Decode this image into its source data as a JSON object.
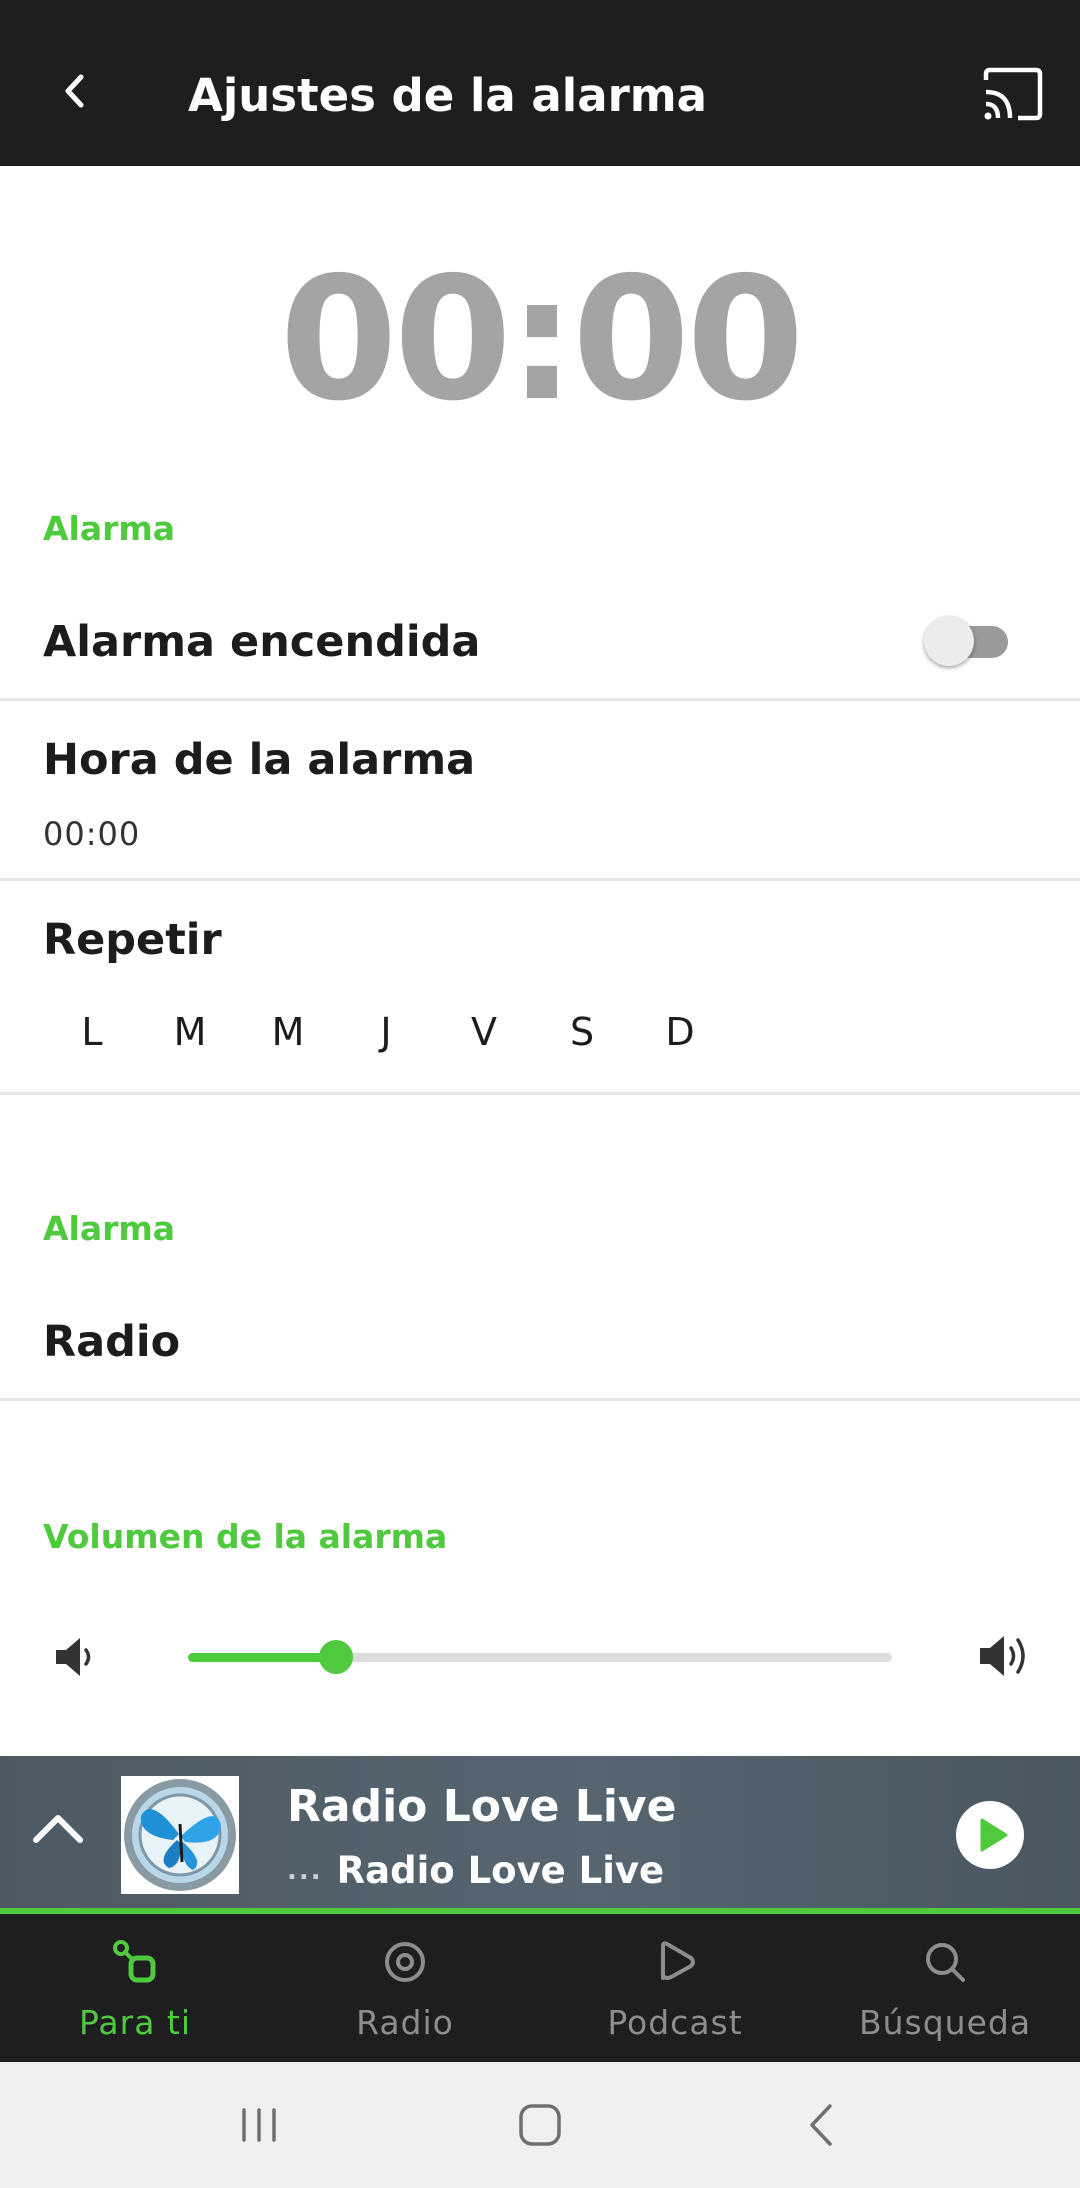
{
  "header": {
    "title": "Ajustes de la alarma"
  },
  "clock": {
    "time": "00:00"
  },
  "alarm_section": {
    "label": "Alarma",
    "switch_label": "Alarma encendida",
    "switch_on": false,
    "time_label": "Hora de la alarma",
    "time_value": "00:00",
    "repeat_label": "Repetir",
    "days": [
      "L",
      "M",
      "M",
      "J",
      "V",
      "S",
      "D"
    ]
  },
  "source_section": {
    "label": "Alarma",
    "source": "Radio"
  },
  "volume_section": {
    "label": "Volumen de la alarma",
    "level": 0.21
  },
  "player": {
    "title": "Radio Love Live",
    "subtitle_prefix": "...",
    "subtitle": "Radio Love Live"
  },
  "tabs": [
    {
      "label": "Para ti",
      "icon": "for-you-icon",
      "active": true
    },
    {
      "label": "Radio",
      "icon": "radio-icon",
      "active": false
    },
    {
      "label": "Podcast",
      "icon": "podcast-icon",
      "active": false
    },
    {
      "label": "Búsqueda",
      "icon": "search-icon",
      "active": false
    }
  ],
  "colors": {
    "accent": "#4fc93d",
    "bar": "#1e1e20",
    "clock": "#a4a4a4"
  }
}
